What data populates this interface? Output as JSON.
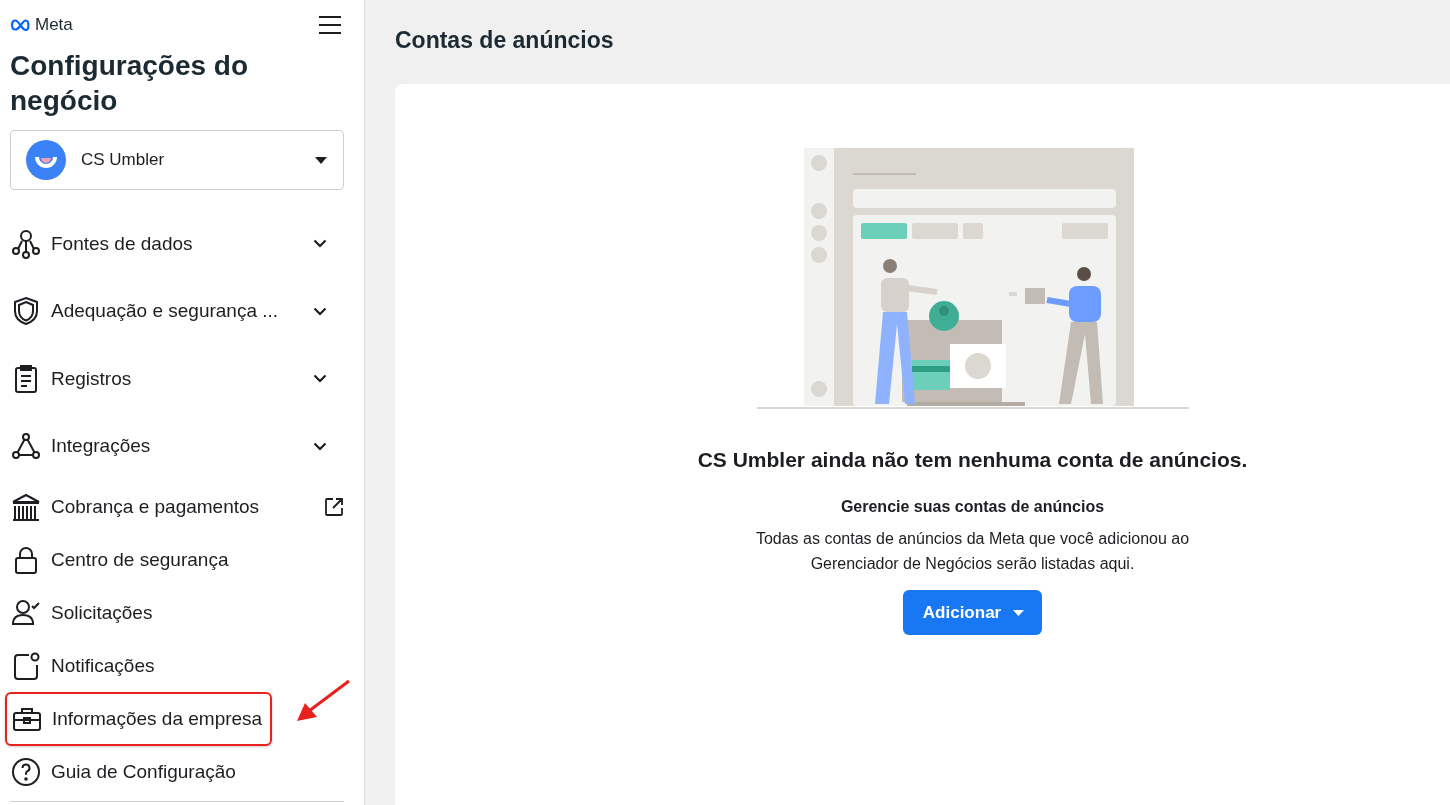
{
  "sidebar": {
    "brand": "Meta",
    "title": "Configurações do negócio",
    "account": {
      "name": "CS Umbler"
    },
    "items": [
      {
        "label": "Fontes de dados",
        "kind": "expandable",
        "highlighted": false
      },
      {
        "label": "Adequação e segurança ...",
        "kind": "expandable",
        "highlighted": false
      },
      {
        "label": "Registros",
        "kind": "expandable",
        "highlighted": false
      },
      {
        "label": "Integrações",
        "kind": "expandable",
        "highlighted": false
      },
      {
        "label": "Cobrança e pagamentos",
        "kind": "external",
        "highlighted": false
      },
      {
        "label": "Centro de segurança",
        "kind": "plain",
        "highlighted": false
      },
      {
        "label": "Solicitações",
        "kind": "plain",
        "highlighted": false
      },
      {
        "label": "Notificações",
        "kind": "plain",
        "highlighted": false
      },
      {
        "label": "Informações da empresa",
        "kind": "plain",
        "highlighted": true
      },
      {
        "label": "Guia de Configuração",
        "kind": "plain",
        "highlighted": false
      }
    ]
  },
  "main": {
    "title": "Contas de anúncios",
    "empty_state": {
      "heading": "CS Umbler ainda não tem nenhuma conta de anúncios.",
      "subheading": "Gerencie suas contas de anúncios",
      "description": "Todas as contas de anúncios da Meta que você adicionou ao Gerenciador de Negócios serão listadas aqui.",
      "button": "Adicionar"
    }
  }
}
